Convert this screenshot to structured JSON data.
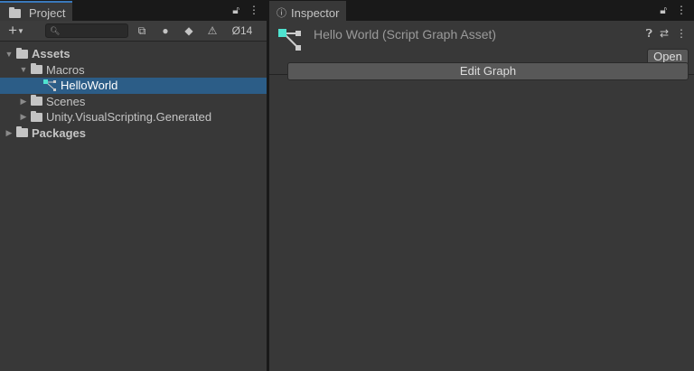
{
  "project": {
    "tab_label": "Project",
    "count": "14",
    "tree": [
      {
        "label": "Assets",
        "bold": true,
        "level": 0,
        "expanded": true,
        "icon": "folder-open-icon"
      },
      {
        "label": "Macros",
        "level": 1,
        "expanded": true,
        "icon": "folder-open-icon"
      },
      {
        "label": "HelloWorld",
        "level": 2,
        "selected": true,
        "icon": "script-graph-icon"
      },
      {
        "label": "Scenes",
        "level": 1,
        "expanded": false,
        "icon": "folder-icon"
      },
      {
        "label": "Unity.VisualScripting.Generated",
        "level": 1,
        "expanded": false,
        "icon": "folder-icon"
      },
      {
        "label": "Packages",
        "bold": true,
        "level": 0,
        "expanded": false,
        "icon": "folder-icon"
      }
    ]
  },
  "inspector": {
    "tab_label": "Inspector",
    "title": "Hello World (Script Graph Asset)",
    "open_label": "Open",
    "edit_graph_label": "Edit Graph"
  },
  "colors": {
    "selection": "#2c5d87",
    "accent": "#3a79bb",
    "graph_node": "#4fe3d0"
  }
}
